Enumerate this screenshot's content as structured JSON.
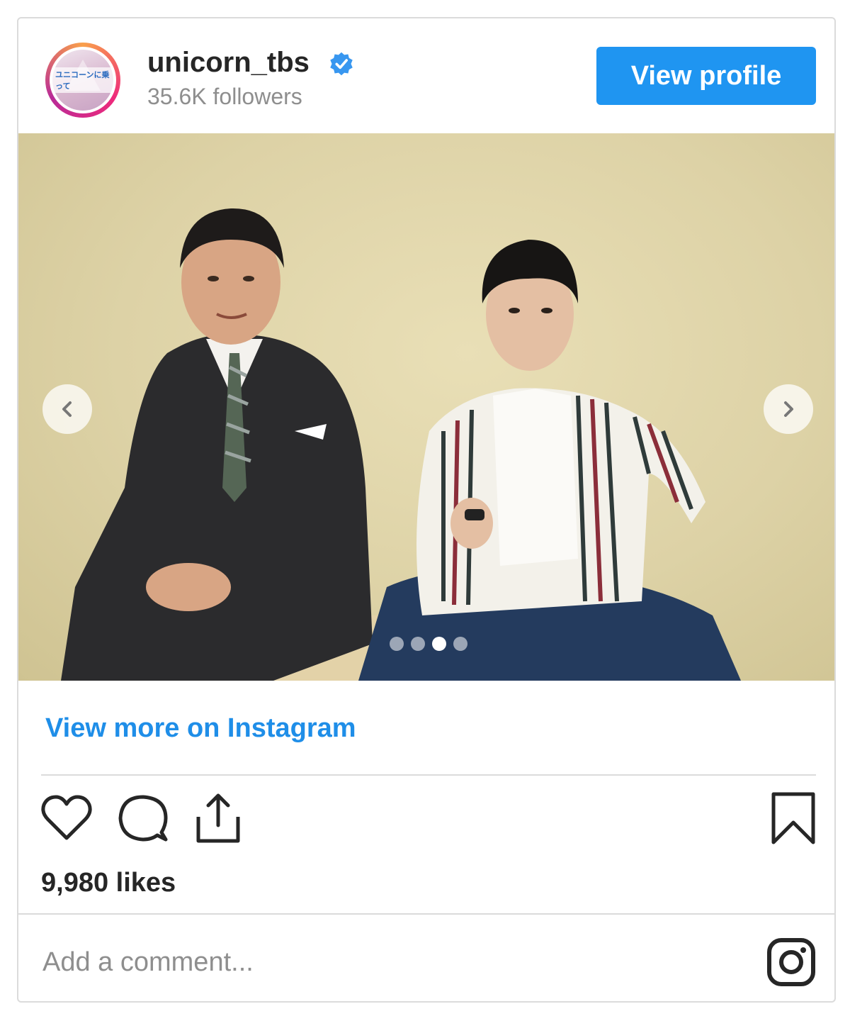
{
  "post": {
    "username": "unicorn_tbs",
    "followers": "35.6K followers",
    "avatar_text": "ユニコーンに乗って",
    "view_profile_label": "View profile",
    "view_more_label": "View more on Instagram",
    "likes": "9,980 likes",
    "comment_placeholder": "Add a comment...",
    "carousel": {
      "slide_count": 4,
      "active_index": 2
    }
  },
  "colors": {
    "accent": "#1f95f1",
    "link": "#1f8ee8",
    "verified": "#3897f0",
    "photo_background": "#ddd2a6"
  },
  "icons": [
    "verified-badge-icon",
    "chevron-left-icon",
    "chevron-right-icon",
    "heart-icon",
    "comment-icon",
    "share-icon",
    "bookmark-icon",
    "instagram-icon"
  ]
}
